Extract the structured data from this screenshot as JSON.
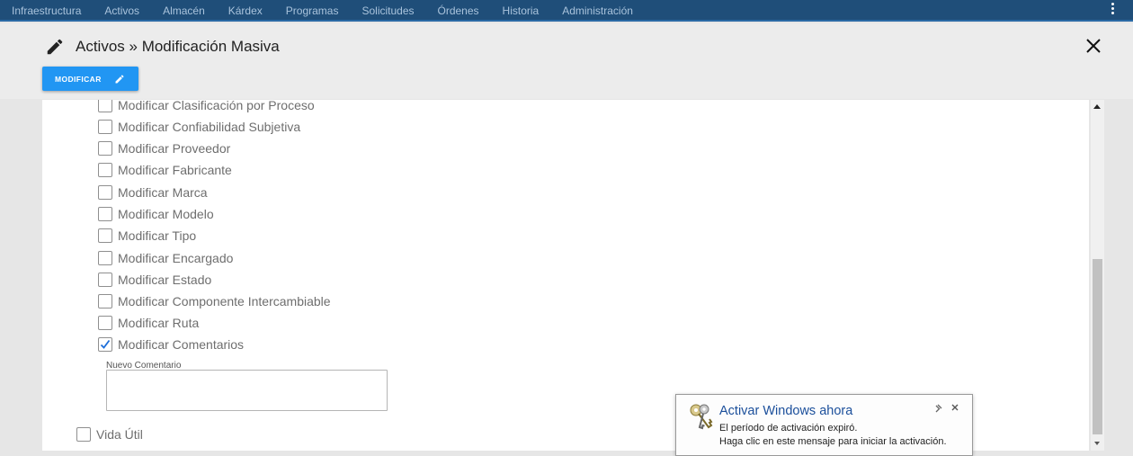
{
  "topnav": {
    "items": [
      "Infraestructura",
      "Activos",
      "Almacén",
      "Kárdex",
      "Programas",
      "Solicitudes",
      "Órdenes",
      "Historia",
      "Administración"
    ],
    "bg_color": "#1f4e79"
  },
  "header": {
    "title": "Activos » Modificación Masiva",
    "title_icon": "pencil-icon",
    "close_icon": "close-icon"
  },
  "toolbar": {
    "modificar_label": "MODIFICAR",
    "accent_color": "#2196f3"
  },
  "options": [
    {
      "label": "Modificar Clasificación por Proceso",
      "checked": false
    },
    {
      "label": "Modificar Confiabilidad Subjetiva",
      "checked": false
    },
    {
      "label": "Modificar Proveedor",
      "checked": false
    },
    {
      "label": "Modificar Fabricante",
      "checked": false
    },
    {
      "label": "Modificar Marca",
      "checked": false
    },
    {
      "label": "Modificar Modelo",
      "checked": false
    },
    {
      "label": "Modificar Tipo",
      "checked": false
    },
    {
      "label": "Modificar Encargado",
      "checked": false
    },
    {
      "label": "Modificar Estado",
      "checked": false
    },
    {
      "label": "Modificar Componente Intercambiable",
      "checked": false
    },
    {
      "label": "Modificar Ruta",
      "checked": false
    },
    {
      "label": "Modificar Comentarios",
      "checked": true
    }
  ],
  "comment_field": {
    "label": "Nuevo Comentario",
    "value": ""
  },
  "vida_util": {
    "label": "Vida Útil",
    "checked": false
  },
  "activation_toast": {
    "title": "Activar Windows ahora",
    "line1": "El período de activación expiró.",
    "line2": "Haga clic en este mensaje para iniciar la activación."
  }
}
